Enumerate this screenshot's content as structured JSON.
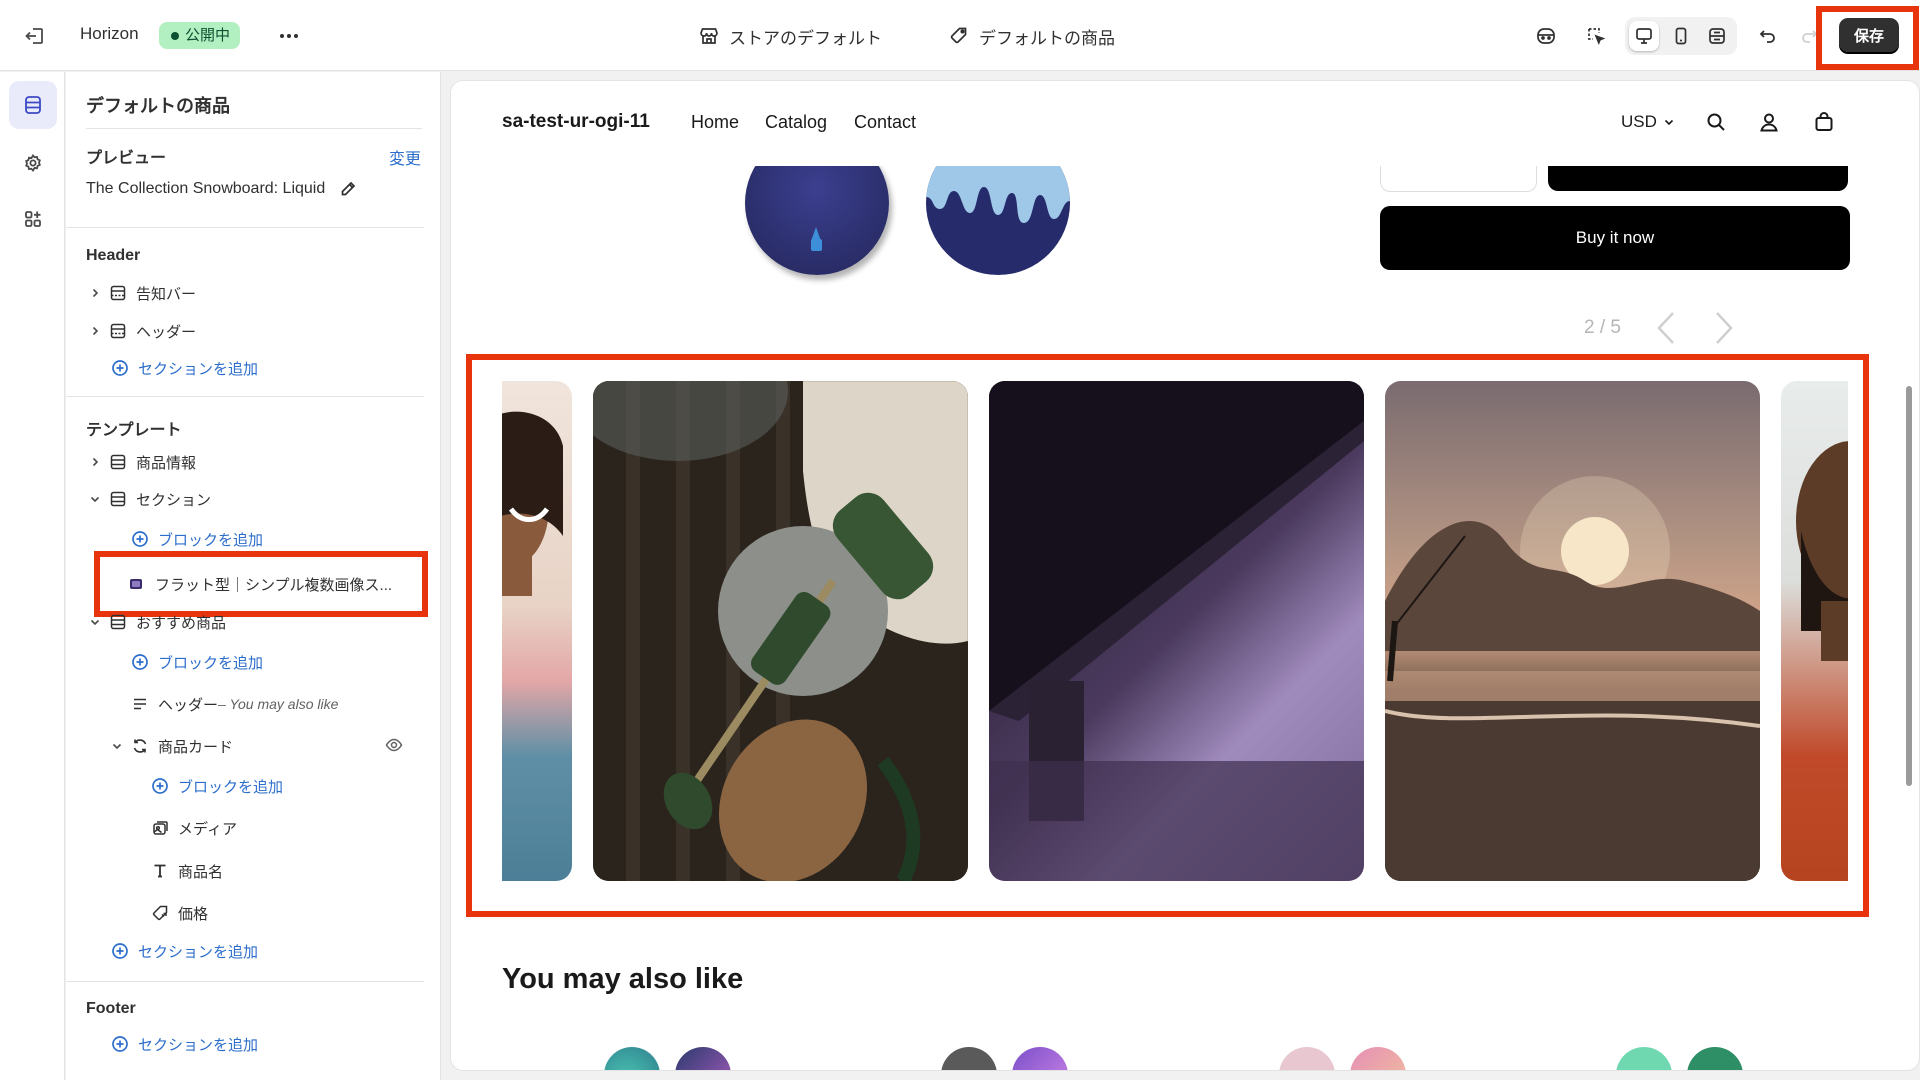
{
  "topbar": {
    "theme_name": "Horizon",
    "status_badge": "公開中",
    "store_default": "ストアのデフォルト",
    "default_product": "デフォルトの商品",
    "save_label": "保存"
  },
  "sidebar": {
    "title": "デフォルトの商品",
    "preview_heading": "プレビュー",
    "change_link": "変更",
    "preview_product": "The Collection Snowboard: Liquid",
    "header_group": "Header",
    "header_items": [
      "告知バー",
      "ヘッダー"
    ],
    "add_section": "セクションを追加",
    "template_group": "テンプレート",
    "template_items": [
      "商品情報",
      "セクション"
    ],
    "add_block": "ブロックを追加",
    "selected_block": "フラット型｜シンプル複数画像ス...",
    "recommended": "おすすめ商品",
    "heading_item": "ヘッダー",
    "heading_item_detail": " – You may also like",
    "product_card": "商品カード",
    "card_children": [
      "メディア",
      "商品名",
      "価格"
    ],
    "footer_group": "Footer"
  },
  "storefront": {
    "store_name": "sa-test-ur-ogi-11",
    "nav": [
      "Home",
      "Catalog",
      "Contact"
    ],
    "currency": "USD",
    "buy_now": "Buy it now",
    "pager": "2 / 5",
    "also_heading": "You may also like"
  },
  "colors": {
    "accent": "#2c6ecb",
    "highlight": "#e8340d",
    "badge_bg": "#b3f0c1"
  }
}
